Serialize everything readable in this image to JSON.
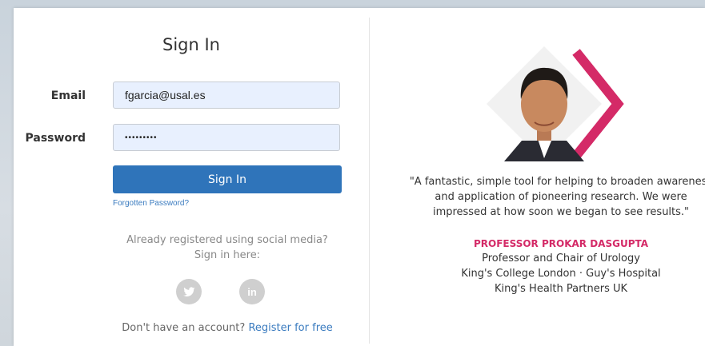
{
  "login": {
    "title": "Sign In",
    "email_label": "Email",
    "email_value": "fgarcia@usal.es",
    "password_label": "Password",
    "password_value": "•••••••••",
    "signin_label": "Sign In",
    "forgot_label": "Forgotten Password?",
    "social_line1": "Already registered using social media?",
    "social_line2": "Sign in here:",
    "social_icons": [
      "twitter-icon",
      "linkedin-icon"
    ],
    "register_prompt": "Don't have an account?",
    "register_link": "Register for free"
  },
  "testimonial": {
    "quote_line1": "\"A fantastic, simple tool for helping to broaden awareness",
    "quote_line2": "and application of pioneering research. We were",
    "quote_line3": "impressed at how soon we began to see results.\"",
    "name": "PROFESSOR PROKAR DASGUPTA",
    "role1": "Professor and Chair of Urology",
    "role2": "King's College London · Guy's Hospital",
    "role3": "King's Health Partners UK"
  },
  "colors": {
    "primary": "#2f74ba",
    "accent": "#d42a67",
    "input_bg": "#e8f0fe"
  }
}
